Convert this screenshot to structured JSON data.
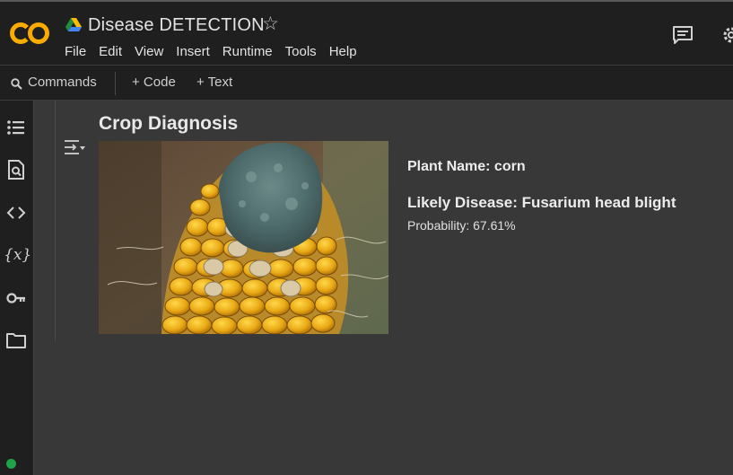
{
  "header": {
    "title": "Disease DETECTION",
    "menu": [
      "File",
      "Edit",
      "View",
      "Insert",
      "Runtime",
      "Tools",
      "Help"
    ]
  },
  "toolbar": {
    "commands": "Commands",
    "code": "+ Code",
    "text": "+ Text"
  },
  "sidebar": {
    "icons": [
      "table-of-contents-icon",
      "find-replace-icon",
      "code-snippets-icon",
      "variables-icon",
      "secrets-key-icon",
      "files-folder-icon"
    ],
    "variables_label": "{x}"
  },
  "output": {
    "title": "Crop Diagnosis",
    "plant_name": "Plant Name: corn",
    "likely_disease": "Likely Disease: Fusarium head blight",
    "probability": "Probability: 67.61%"
  },
  "colors": {
    "logo_orange": "#f9ab00",
    "background": "#383838",
    "chrome": "#1f1f1f",
    "connected_green": "#1fa34a"
  }
}
